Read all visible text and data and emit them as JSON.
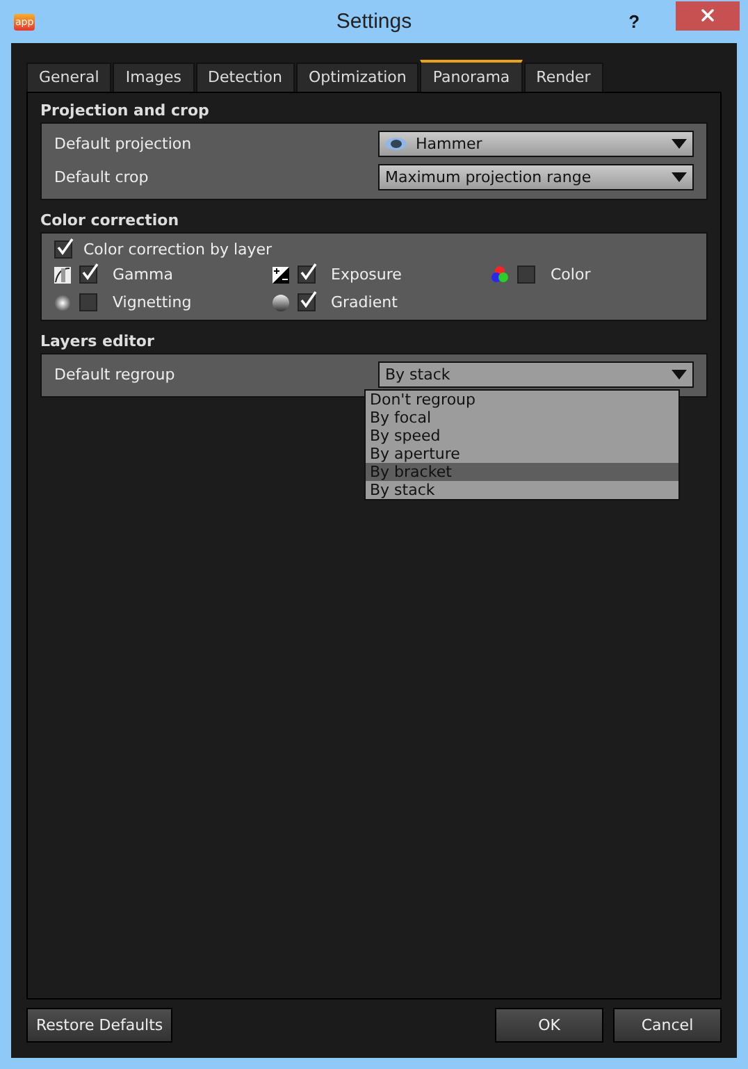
{
  "window": {
    "app_badge": "app",
    "title": "Settings",
    "help": "?"
  },
  "tabs": [
    {
      "label": "General",
      "selected": false
    },
    {
      "label": "Images",
      "selected": false
    },
    {
      "label": "Detection",
      "selected": false
    },
    {
      "label": "Optimization",
      "selected": false
    },
    {
      "label": "Panorama",
      "selected": true
    },
    {
      "label": "Render",
      "selected": false
    }
  ],
  "projection_and_crop": {
    "title": "Projection and crop",
    "fields": [
      {
        "label": "Default projection",
        "value": "Hammer",
        "has_icon": true
      },
      {
        "label": "Default crop",
        "value": "Maximum projection range",
        "has_icon": false
      }
    ]
  },
  "color_correction": {
    "title": "Color correction",
    "by_layer": {
      "label": "Color correction by layer",
      "checked": true
    },
    "options": [
      {
        "label": "Gamma",
        "checked": true
      },
      {
        "label": "Exposure",
        "checked": true
      },
      {
        "label": "Color",
        "checked": false
      },
      {
        "label": "Vignetting",
        "checked": false
      },
      {
        "label": "Gradient",
        "checked": true
      }
    ]
  },
  "layers_editor": {
    "title": "Layers editor",
    "field": {
      "label": "Default regroup",
      "value": "By stack",
      "expanded": true,
      "options": [
        {
          "label": "Don't regroup",
          "highlighted": false
        },
        {
          "label": "By focal",
          "highlighted": false
        },
        {
          "label": "By speed",
          "highlighted": false
        },
        {
          "label": "By aperture",
          "highlighted": false
        },
        {
          "label": "By bracket",
          "highlighted": true
        },
        {
          "label": "By stack",
          "highlighted": false
        }
      ]
    }
  },
  "buttons": {
    "restore": "Restore Defaults",
    "ok": "OK",
    "cancel": "Cancel"
  }
}
